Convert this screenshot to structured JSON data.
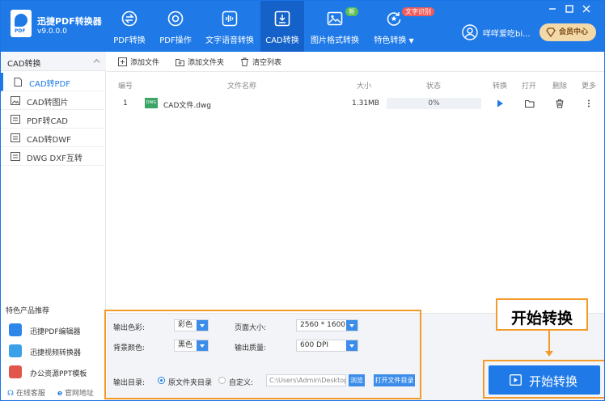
{
  "app": {
    "name": "迅捷PDF转换器",
    "version": "v9.0.0.0"
  },
  "nav": {
    "tabs": [
      {
        "label": "PDF转换",
        "icon": "convert-icon"
      },
      {
        "label": "PDF操作",
        "icon": "target-icon"
      },
      {
        "label": "文字语音转换",
        "icon": "audio-wave-icon"
      },
      {
        "label": "CAD转换",
        "icon": "cad-download-icon",
        "active": true
      },
      {
        "label": "图片格式转换",
        "icon": "image-icon",
        "badge": "新"
      },
      {
        "label": "特色转换",
        "icon": "refresh-star-icon",
        "badge": "文字识别",
        "dropdown": true
      }
    ]
  },
  "user": {
    "name": "咩咩爱吃bi...",
    "vip_label": "会员中心"
  },
  "sidebar": {
    "section_title": "CAD转换",
    "items": [
      {
        "label": "CAD转PDF",
        "icon": "file-pdf-icon",
        "active": true
      },
      {
        "label": "CAD转图片",
        "icon": "image-icon"
      },
      {
        "label": "PDF转CAD",
        "icon": "file-icon"
      },
      {
        "label": "CAD转DWF",
        "icon": "file-icon"
      },
      {
        "label": "DWG DXF互转",
        "icon": "file-icon"
      }
    ],
    "featured_title": "特色产品推荐",
    "featured": [
      {
        "label": "迅捷PDF编辑器",
        "icon": "pdf-editor-icon",
        "color": "#2f86e9"
      },
      {
        "label": "迅捷视频转换器",
        "icon": "video-converter-icon",
        "color": "#3aa0e8"
      },
      {
        "label": "办公资源PPT模板",
        "icon": "ppt-template-icon",
        "color": "#e2574c"
      }
    ],
    "links": [
      {
        "label": "在线客服",
        "icon": "headset-icon"
      },
      {
        "label": "官网地址",
        "icon": "browser-icon"
      }
    ]
  },
  "toolbar": {
    "add_file": "添加文件",
    "add_folder": "添加文件夹",
    "clear_list": "清空列表"
  },
  "table": {
    "headers": {
      "index": "编号",
      "filename": "文件名称",
      "size": "大小",
      "status": "状态",
      "convert": "转换",
      "open": "打开",
      "delete": "删除",
      "more": "更多"
    },
    "rows": [
      {
        "index": "1",
        "file_badge": "DWG",
        "filename": "CAD文件.dwg",
        "size": "1.31MB",
        "progress": "0%"
      }
    ]
  },
  "settings": {
    "output_color_label": "输出色彩:",
    "output_color_value": "彩色",
    "bg_color_label": "背景颜色:",
    "bg_color_value": "黑色",
    "page_size_label": "页面大小:",
    "page_size_value": "2560 * 1600",
    "quality_label": "输出质量:",
    "quality_value": "600 DPI",
    "output_dir_label": "输出目录:",
    "radio_original": "原文件夹目录",
    "radio_custom": "自定义:",
    "path_value": "C:\\Users\\Admin\\Desktop",
    "browse_label": "浏览",
    "open_dir_label": "打开文件目录"
  },
  "start_button": "开始转换",
  "callout": "开始转换",
  "colors": {
    "primary": "#1f7ae8",
    "highlight": "#f49a2a",
    "vip": "#f3d9a8"
  }
}
